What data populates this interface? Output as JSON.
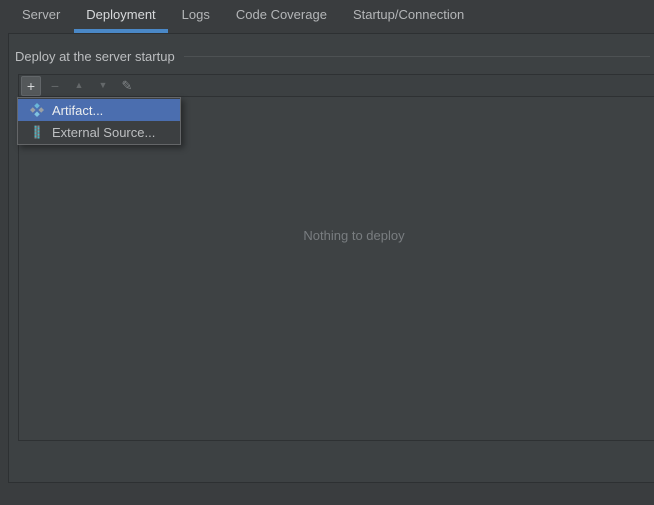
{
  "tabs": [
    {
      "label": "Server",
      "active": false
    },
    {
      "label": "Deployment",
      "active": true
    },
    {
      "label": "Logs",
      "active": false
    },
    {
      "label": "Code Coverage",
      "active": false
    },
    {
      "label": "Startup/Connection",
      "active": false
    }
  ],
  "panel": {
    "group_title": "Deploy at the server startup",
    "empty_message": "Nothing to deploy"
  },
  "toolbar": {
    "buttons": [
      {
        "name": "add",
        "glyph": "+",
        "state": "pressed"
      },
      {
        "name": "remove",
        "glyph": "−",
        "state": "disabled"
      },
      {
        "name": "move-up",
        "glyph": "▲",
        "state": "disabled"
      },
      {
        "name": "move-down",
        "glyph": "▼",
        "state": "disabled"
      },
      {
        "name": "edit",
        "glyph": "✎",
        "state": "disabled"
      }
    ]
  },
  "popup": {
    "items": [
      {
        "label": "Artifact...",
        "icon": "artifact-icon",
        "selected": true
      },
      {
        "label": "External Source...",
        "icon": "external-source-icon",
        "selected": false
      }
    ]
  },
  "colors": {
    "accent_underline": "#4a88c7",
    "selection": "#4b6eaf",
    "background": "#3a3d3f",
    "panel_background": "#3e4244",
    "artifact_blue": "#6ab6d8",
    "artifact_gray": "#9aa0a4",
    "zip_teal": "#43bac6"
  }
}
